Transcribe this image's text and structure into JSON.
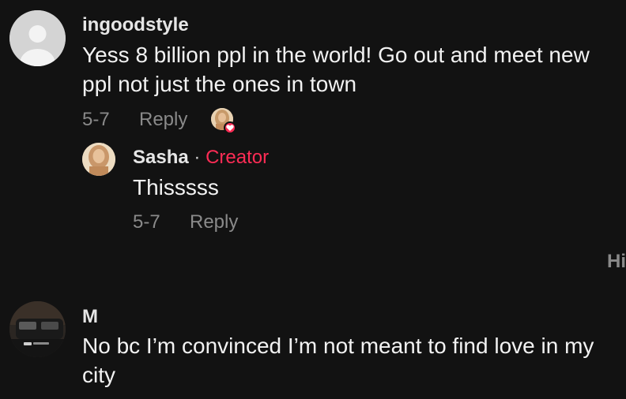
{
  "comments": [
    {
      "username": "ingoodstyle",
      "text": "Yess 8 billion ppl in the world! Go out and meet new ppl not just the ones in town",
      "date": "5-7",
      "reply_label": "Reply",
      "avatar_icon": "default-user-icon",
      "creator_liked": true,
      "replies": [
        {
          "username": "Sasha",
          "separator": "·",
          "creator_label": "Creator",
          "text": "Thisssss",
          "date": "5-7",
          "reply_label": "Reply"
        }
      ]
    },
    {
      "username": "M",
      "text": "No bc I’m convinced I’m not meant to find love in my city"
    }
  ],
  "hide_label": "Hi",
  "colors": {
    "background": "#121212",
    "accent": "#fe2c55",
    "muted": "#8a8a8a"
  }
}
